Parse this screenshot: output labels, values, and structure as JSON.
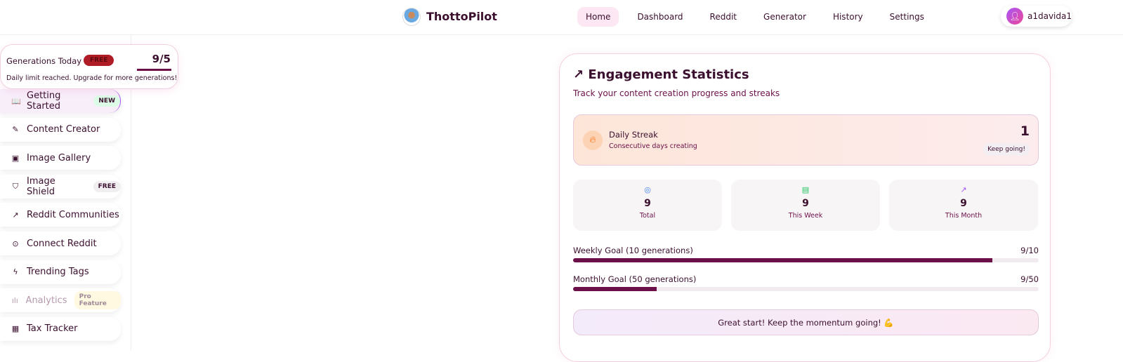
{
  "header": {
    "brand": "ThottoPilot",
    "nav": [
      "Home",
      "Dashboard",
      "Reddit",
      "Generator",
      "History",
      "Settings"
    ],
    "active": "Home",
    "user": "a1davida1"
  },
  "generations": {
    "label": "Generations Today",
    "badge": "FREE",
    "count": "9/5",
    "used": 9,
    "limit": 5,
    "message": "Daily limit reached. Upgrade for more generations!"
  },
  "sidebar": {
    "items": [
      {
        "label": "Getting Started",
        "icon": "book-icon",
        "glyph": "📖",
        "tag": "NEW"
      },
      {
        "label": "Content Creator",
        "icon": "pen-icon",
        "glyph": "✎"
      },
      {
        "label": "Image Gallery",
        "icon": "image-icon",
        "glyph": "▣"
      },
      {
        "label": "Image Shield",
        "icon": "shield-icon",
        "glyph": "⛉",
        "tag": "FREE"
      },
      {
        "label": "Reddit Communities",
        "icon": "trending-icon",
        "glyph": "↗"
      },
      {
        "label": "Connect Reddit",
        "icon": "play-circle-icon",
        "glyph": "⊙"
      },
      {
        "label": "Trending Tags",
        "icon": "zap-icon",
        "glyph": "ϟ"
      },
      {
        "label": "Analytics",
        "icon": "bar-chart-icon",
        "glyph": "ılı",
        "tag": "Pro Feature"
      },
      {
        "label": "Tax Tracker",
        "icon": "calculator-icon",
        "glyph": "▦"
      }
    ]
  },
  "stats": {
    "title": "Engagement Statistics",
    "subtitle": "Track your content creation progress and streaks",
    "streak": {
      "label": "Daily Streak",
      "sub": "Consecutive days creating",
      "value": "1",
      "badge": "Keep going!"
    },
    "cards": [
      {
        "value": "9",
        "label": "Total",
        "icon": "target-icon",
        "color": "#3b82f6"
      },
      {
        "value": "9",
        "label": "This Week",
        "icon": "calendar-icon",
        "color": "#22c55e"
      },
      {
        "value": "9",
        "label": "This Month",
        "icon": "trending-up-icon",
        "color": "#a855f7"
      }
    ],
    "weekly": {
      "label": "Weekly Goal (10 generations)",
      "value": "9/10",
      "percent": 90
    },
    "monthly": {
      "label": "Monthly Goal (50 generations)",
      "value": "9/50",
      "percent": 18
    },
    "message": "Great start! Keep the momentum going! 💪"
  }
}
